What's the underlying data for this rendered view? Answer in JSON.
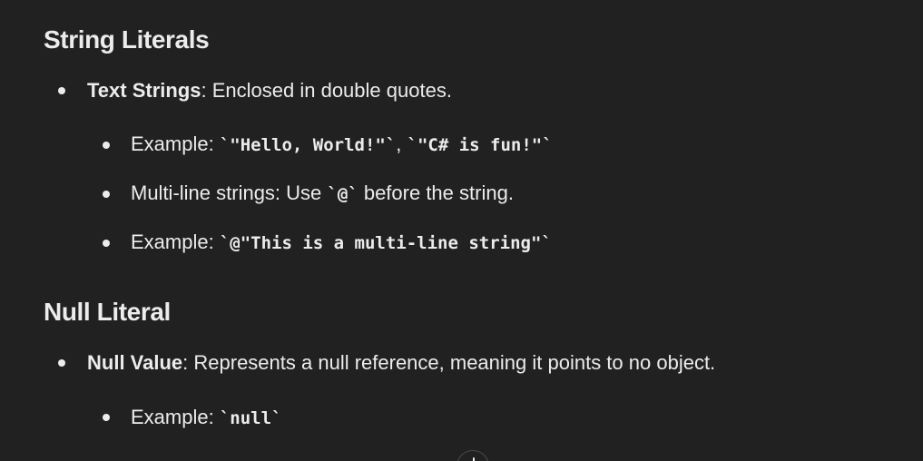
{
  "sections": [
    {
      "heading": "String Literals",
      "items": [
        {
          "label": "Text Strings",
          "text": ": Enclosed in double quotes.",
          "subitems": [
            {
              "prefix": "Example: ",
              "code1": "`\"Hello, World!\"`",
              "sep": ", ",
              "code2": "`\"C# is fun!\"`"
            },
            {
              "prefix": "Multi-line strings: Use ",
              "code1": "`@`",
              "suffix": " before the string."
            },
            {
              "prefix": "Example: ",
              "code1": "`@\"This is a multi-line string\"`"
            }
          ]
        }
      ]
    },
    {
      "heading": "Null Literal",
      "items": [
        {
          "label": "Null Value",
          "text": ": Represents a null reference, meaning it points to no object.",
          "subitems": [
            {
              "prefix": "Example: ",
              "code1": "`null`"
            }
          ]
        }
      ]
    }
  ],
  "scroll_button": {
    "icon": "arrow-down-icon"
  }
}
